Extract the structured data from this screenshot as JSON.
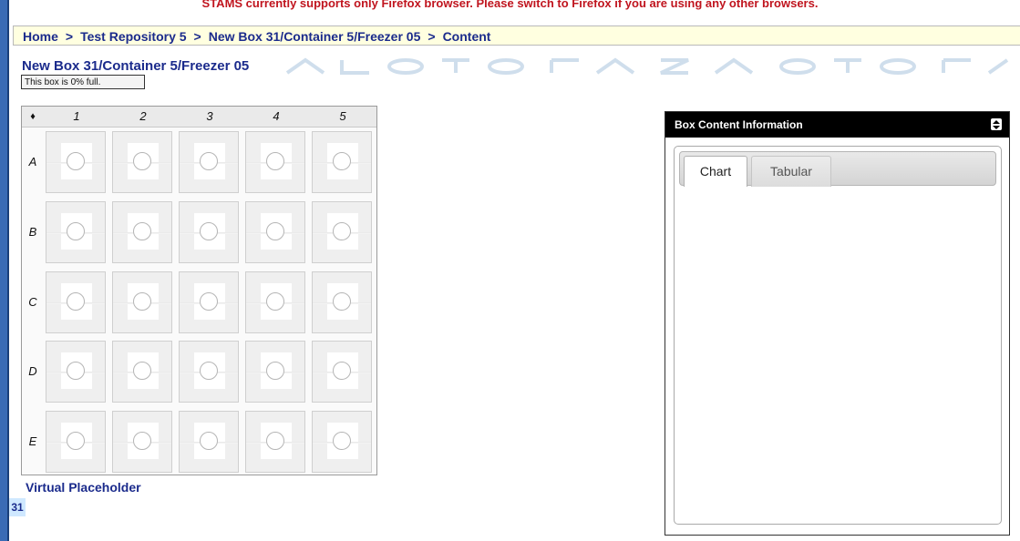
{
  "banner": {
    "warning_text": "STAMS currently supports only Firefox browser. Please switch to Firefox if you are using any other browsers."
  },
  "breadcrumb": {
    "items": [
      {
        "label": "Home"
      },
      {
        "label": "Test Repository 5"
      },
      {
        "label": "New Box 31/Container 5/Freezer 05"
      },
      {
        "label": "Content"
      }
    ],
    "separator": ">"
  },
  "box": {
    "title": "New Box 31/Container 5/Freezer 05",
    "fill_status": "This box is 0% full.",
    "fill_percent": 0,
    "grid": {
      "corner_symbol": "♦",
      "columns": [
        "1",
        "2",
        "3",
        "4",
        "5"
      ],
      "rows": [
        "A",
        "B",
        "C",
        "D",
        "E"
      ]
    }
  },
  "footer": {
    "virtual_placeholder_label": "Virtual Placeholder",
    "corner_badge": "31"
  },
  "panel": {
    "title": "Box Content Information",
    "toggle_icon": "up-down-arrows-icon",
    "tabs": [
      {
        "label": "Chart",
        "active": true
      },
      {
        "label": "Tabular",
        "active": false
      }
    ]
  },
  "colors": {
    "warning": "#c0141e",
    "link_blue": "#1b2b8c",
    "breadcrumb_bg": "#ffffe0",
    "panel_header": "#000000",
    "frame_blue": "#3a6bb5"
  }
}
